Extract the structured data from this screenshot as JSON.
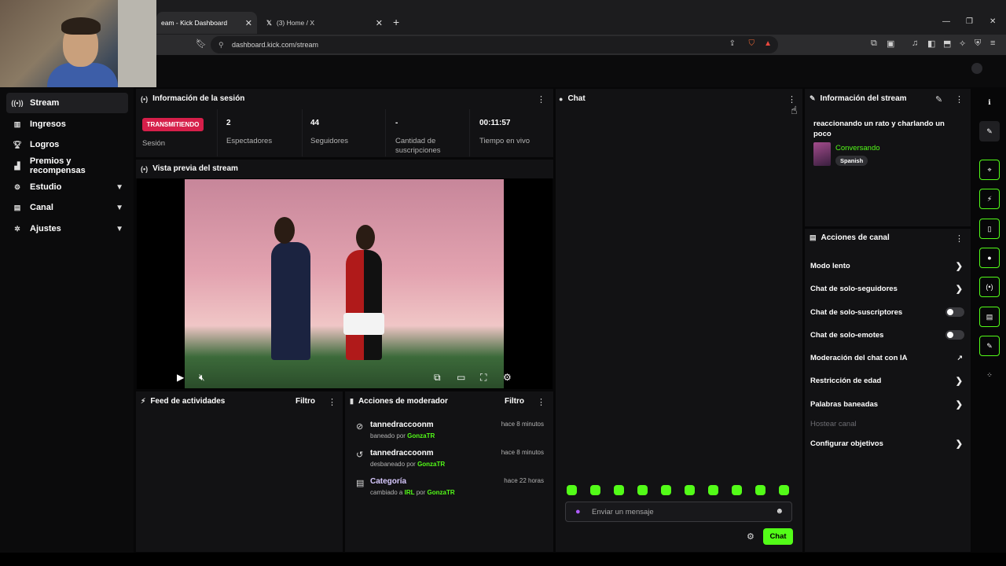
{
  "browser": {
    "tabs": [
      {
        "label": "eam - Kick Dashboard"
      },
      {
        "label": "(3) Home / X"
      }
    ],
    "url": "dashboard.kick.com/stream"
  },
  "sidebar": {
    "items": [
      {
        "label": "Stream",
        "icon": "broadcast-icon",
        "active": true
      },
      {
        "label": "Ingresos",
        "icon": "chart-icon"
      },
      {
        "label": "Logros",
        "icon": "trophy-icon"
      },
      {
        "label": "Premios y recompensas",
        "icon": "gift-icon"
      },
      {
        "label": "Estudio",
        "icon": "gear-icon",
        "expandable": true
      },
      {
        "label": "Canal",
        "icon": "layout-icon",
        "expandable": true
      },
      {
        "label": "Ajustes",
        "icon": "settings-icon",
        "expandable": true
      }
    ]
  },
  "session": {
    "title": "Información de la sesión",
    "badge": "TRANSMITIENDO",
    "badge_label": "Sesión",
    "stats": [
      {
        "value": "2",
        "label": "Espectadores"
      },
      {
        "value": "44",
        "label": "Seguidores"
      },
      {
        "value": "-",
        "label": "Cantidad de suscripciones"
      },
      {
        "value": "00:11:57",
        "label": "Tiempo en vivo"
      }
    ]
  },
  "preview": {
    "title": "Vista previa del stream"
  },
  "activity": {
    "title": "Feed de actividades",
    "filter": "Filtro"
  },
  "moderator": {
    "title": "Acciones de moderador",
    "filter": "Filtro",
    "rows": [
      {
        "user": "tannedraccoonm",
        "action": "baneado por",
        "by": "GonzaTR",
        "time": "hace 8 minutos",
        "icon": "ban-icon"
      },
      {
        "user": "tannedraccoonm",
        "action": "desbaneado por",
        "by": "GonzaTR",
        "time": "hace 8 minutos",
        "icon": "undo-icon"
      },
      {
        "user": "Categoría",
        "action": "cambiado a",
        "target": "IRL",
        "mid": "por",
        "by": "GonzaTR",
        "time": "hace 22 horas",
        "icon": "category-icon"
      }
    ]
  },
  "chat": {
    "title": "Chat",
    "placeholder": "Enviar un mensaje",
    "send_label": "Chat"
  },
  "stream_info": {
    "title": "Información del stream",
    "stream_title": "reaccionando un rato y charlando un poco",
    "category": "Conversando",
    "language": "Spanish"
  },
  "channel_actions": {
    "title": "Acciones de canal",
    "items": [
      {
        "label": "Modo lento",
        "control": "chevron"
      },
      {
        "label": "Chat de solo-seguidores",
        "control": "chevron"
      },
      {
        "label": "Chat de solo-suscriptores",
        "control": "toggle"
      },
      {
        "label": "Chat de solo-emotes",
        "control": "toggle"
      },
      {
        "label": "Moderación del chat con IA",
        "control": "external"
      },
      {
        "label": "Restricción de edad",
        "control": "chevron"
      },
      {
        "label": "Palabras baneadas",
        "control": "chevron"
      },
      {
        "label": "Hostear canal",
        "control": "none",
        "disabled": true
      },
      {
        "label": "Configurar objetivos",
        "control": "chevron"
      }
    ]
  },
  "colors": {
    "accent": "#53fc18",
    "live": "#d61f4a",
    "panel": "#121214"
  }
}
